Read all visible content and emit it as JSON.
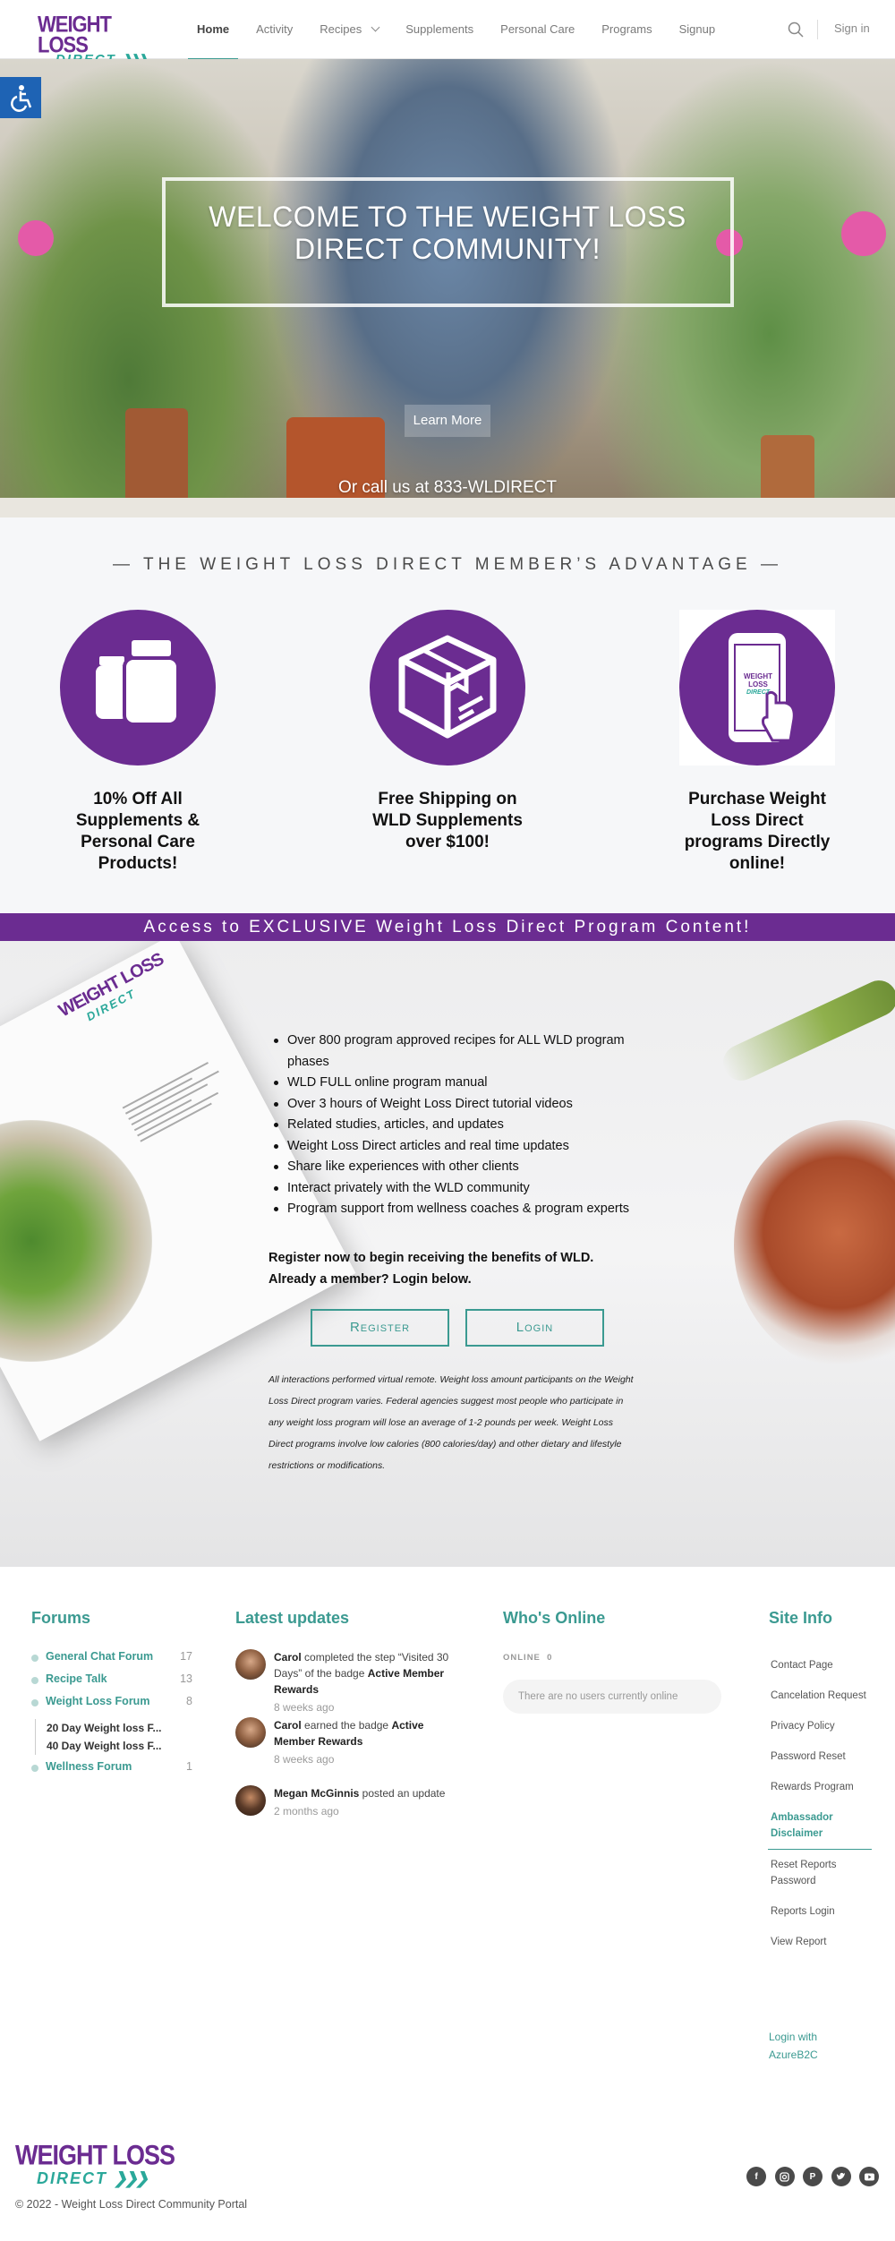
{
  "header": {
    "logo_line1": "WEIGHT LOSS",
    "logo_line2": "DIRECT",
    "nav": [
      "Home",
      "Activity",
      "Recipes",
      "Supplements",
      "Personal Care",
      "Programs",
      "Signup"
    ],
    "active_nav": "Home",
    "signin": "Sign in"
  },
  "hero": {
    "title": "WELCOME TO THE WEIGHT LOSS DIRECT COMMUNITY!",
    "button": "Learn More",
    "call": "Or call us at 833-WLDIRECT"
  },
  "advantage": {
    "title": "— THE WEIGHT LOSS DIRECT MEMBER’S ADVANTAGE —",
    "items": [
      {
        "text": "10% Off All Supplements & Personal Care Products!",
        "icon": "supplement-bottles-icon"
      },
      {
        "text": "Free Shipping on WLD Supplements over $100!",
        "icon": "shipping-box-icon"
      },
      {
        "text": "Purchase Weight Loss Direct programs Directly online!",
        "icon": "phone-tap-icon"
      }
    ],
    "phone_logo_line1": "WEIGHT LOSS",
    "phone_logo_line2": "DIRECT"
  },
  "banner": "Access to EXCLUSIVE Weight Loss Direct Program Content!",
  "program": {
    "book_logo_line1": "WEIGHT LOSS",
    "book_logo_line2": "DIRECT",
    "features": [
      "Over 800 program approved recipes for ALL WLD program phases",
      "WLD FULL online program manual",
      "Over 3 hours of Weight Loss Direct tutorial videos",
      "Related studies, articles, and updates",
      "Weight Loss Direct articles and real time updates",
      "Share like experiences with other clients",
      "Interact privately with the WLD community",
      "Program support from wellness coaches & program experts"
    ],
    "cta_line1": "Register now to begin receiving the benefits of WLD.",
    "cta_line2": "Already a member? Login below.",
    "register": "Register",
    "login": "Login",
    "disclaimer": "All interactions performed virtual remote. Weight loss amount participants on the Weight Loss Direct program varies. Federal agencies suggest most people who participate in any weight loss program will lose an average of 1-2 pounds per week. Weight Loss Direct programs involve low calories (800 calories/day) and other dietary and lifestyle restrictions or modifications."
  },
  "forums": {
    "title": "Forums",
    "items": [
      {
        "name": "General Chat Forum",
        "count": "17"
      },
      {
        "name": "Recipe Talk",
        "count": "13"
      },
      {
        "name": "Weight Loss Forum",
        "count": "8"
      }
    ],
    "subforums": [
      "20 Day Weight loss F...",
      "40 Day Weight loss F..."
    ],
    "last": {
      "name": "Wellness Forum",
      "count": "1"
    }
  },
  "updates": {
    "title": "Latest updates",
    "items": [
      {
        "user": "Carol",
        "pre": " completed the step “Visited 30 Days” of the badge ",
        "badge": "Active Member Rewards",
        "time": "8 weeks ago"
      },
      {
        "user": "Carol",
        "pre": " earned the badge ",
        "badge": "Active Member Rewards",
        "time": "8 weeks ago"
      },
      {
        "user": "Megan McGinnis",
        "pre": " posted an update",
        "badge": "",
        "time": "2 months ago"
      }
    ]
  },
  "online": {
    "title": "Who's Online",
    "label": "ONLINE",
    "count": "0",
    "empty": "There are no users currently online"
  },
  "siteinfo": {
    "title": "Site Info",
    "items": [
      "Contact Page",
      "Cancelation Request",
      "Privacy Policy",
      "Password Reset",
      "Rewards Program",
      "Ambassador Disclaimer",
      "Reset Reports Password",
      "Reports Login",
      "View Report"
    ],
    "active": "Ambassador Disclaimer",
    "azure": "Login with AzureB2C"
  },
  "footer": {
    "logo_line1": "WEIGHT LOSS",
    "logo_line2": "DIRECT",
    "copyright": "© 2022 - Weight Loss Direct Community Portal",
    "socials": [
      "facebook-icon",
      "instagram-icon",
      "pinterest-icon",
      "twitter-icon",
      "youtube-icon"
    ]
  },
  "colors": {
    "brand_purple": "#6b2c91",
    "brand_teal": "#3b9a91",
    "accessibility_blue": "#1e63b4"
  }
}
